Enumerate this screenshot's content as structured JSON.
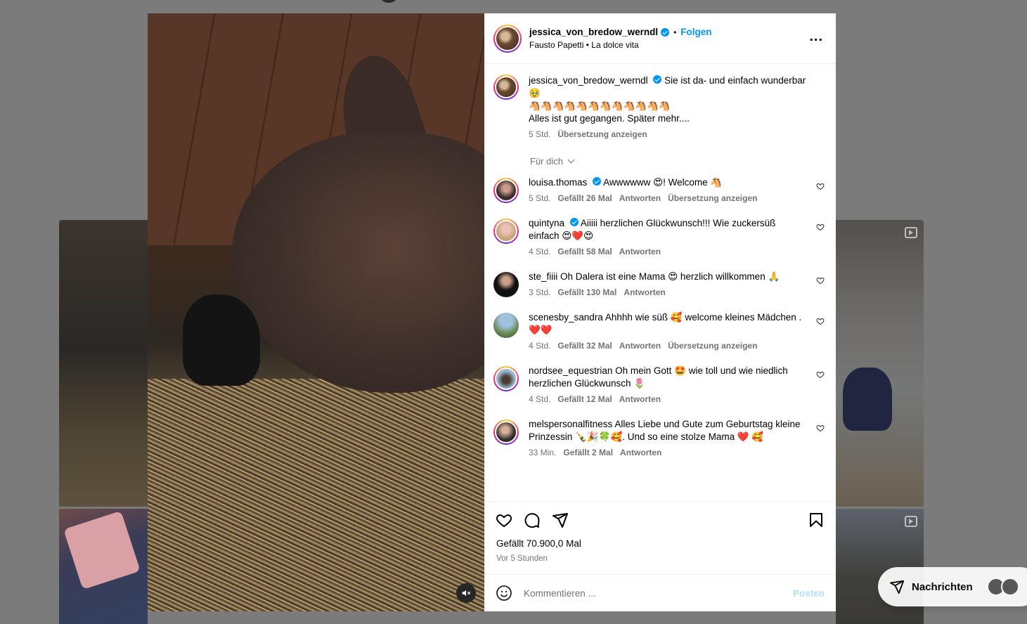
{
  "post": {
    "username": "jessica_von_bredow_werndl",
    "follow_label": "Folgen",
    "separator": "•",
    "music_artist": "Fausto Papetti",
    "music_track": "La dolce vita",
    "more_label": "..."
  },
  "caption": {
    "username": "jessica_von_bredow_werndl",
    "text_line1": "Sie ist da- und einfach wunderbar🥹",
    "text_line2": "🐴🐴🐴🐴🐴🐴🐴🐴🐴🐴🐴🐴",
    "text_line3": "Alles ist gut gegangen. Später mehr....",
    "time": "5 Std.",
    "translate": "Übersetzung anzeigen"
  },
  "filter": {
    "label": "Für dich"
  },
  "comments": [
    {
      "user": "louisa.thomas",
      "verified": true,
      "text": "Awwwwww 😍! Welcome 🐴",
      "time": "5 Std.",
      "likes": "Gefällt 26 Mal",
      "reply": "Antworten",
      "translate": "Übersetzung anzeigen"
    },
    {
      "user": "quintyna",
      "verified": true,
      "text": "Aiiiii herzlichen Glückwunsch!!! Wie zuckersüß einfach 😍❤️😍",
      "time": "4 Std.",
      "likes": "Gefällt 58 Mal",
      "reply": "Antworten",
      "translate": ""
    },
    {
      "user": "ste_fiiii",
      "verified": false,
      "text": "Oh Dalera ist eine Mama 😍 herzlich willkommen 🙏",
      "time": "3 Std.",
      "likes": "Gefällt 130 Mal",
      "reply": "Antworten",
      "translate": ""
    },
    {
      "user": "scenesby_sandra",
      "verified": false,
      "text": "Ahhhh wie süß 🥰 welcome kleines Mädchen . ❤️❤️",
      "time": "4 Std.",
      "likes": "Gefällt 32 Mal",
      "reply": "Antworten",
      "translate": "Übersetzung anzeigen"
    },
    {
      "user": "nordsee_equestrian",
      "verified": false,
      "text": "Oh mein Gott 🤩 wie toll und wie niedlich herzlichen Glückwunsch 🌷",
      "time": "4 Std.",
      "likes": "Gefällt 12 Mal",
      "reply": "Antworten",
      "translate": ""
    },
    {
      "user": "melspersonalfitness",
      "verified": false,
      "text": "Alles Liebe und Gute zum Geburtstag kleine Prinzessin 🍾🎉🍀🥰. Und so eine stolze Mama ❤️ 🥰",
      "time": "33 Min.",
      "likes": "Gefällt 2 Mal",
      "reply": "Antworten",
      "translate": ""
    }
  ],
  "stats": {
    "likes": "Gefällt 70.900,0 Mal",
    "posted": "Vor 5 Stunden"
  },
  "composer": {
    "placeholder": "Kommentieren ...",
    "post_label": "Posten"
  },
  "messages": {
    "label": "Nachrichten"
  },
  "colors": {
    "accent": "#0095f6",
    "muted": "#737373",
    "backdrop": "#7b7b7b"
  }
}
